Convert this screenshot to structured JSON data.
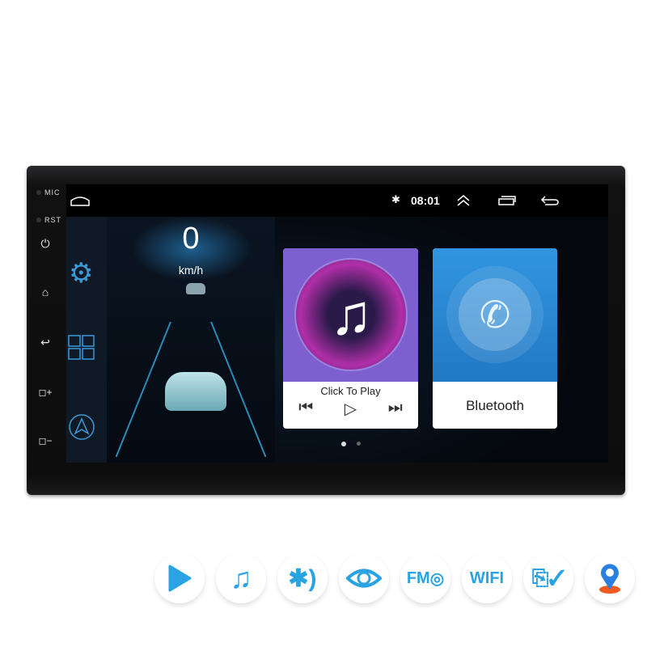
{
  "device": {
    "side_labels": {
      "mic": "MIC",
      "rst": "RST"
    },
    "hardware_buttons": [
      "power-icon",
      "home-icon",
      "back-icon",
      "volume-up-icon",
      "volume-down-icon"
    ]
  },
  "status_bar": {
    "time": "08:01",
    "icons": [
      "home-outline-icon",
      "bluetooth-icon",
      "chevrons-up-icon",
      "recent-apps-icon",
      "back-icon"
    ]
  },
  "sidebar": {
    "items": [
      "gear-icon",
      "apps-grid-icon",
      "navigation-icon"
    ]
  },
  "speed": {
    "value": "0",
    "unit": "km/h"
  },
  "music_card": {
    "label": "Click To Play",
    "controls": [
      "previous-icon",
      "play-icon",
      "next-icon"
    ],
    "color": "#7e5fd0"
  },
  "bluetooth_card": {
    "label": "Bluetooth",
    "color": "#2f8fdc"
  },
  "page_indicator": {
    "pages": 2,
    "active": 1
  },
  "features": {
    "items": [
      "play-icon",
      "music-icon",
      "bluetooth-icon",
      "eye-icon",
      "fm-icon",
      "wifi-icon",
      "usb-icon",
      "location-icon"
    ],
    "fm_text": "FM",
    "wifi_text": "WIFI"
  },
  "colors": {
    "accent": "#2aa3e3",
    "location": "#f05a1e"
  }
}
